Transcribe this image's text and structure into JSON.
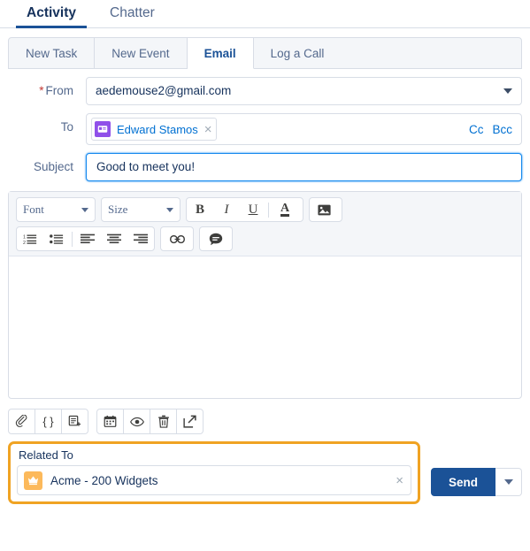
{
  "top_tabs": [
    {
      "label": "Activity",
      "active": true
    },
    {
      "label": "Chatter",
      "active": false
    }
  ],
  "sub_tabs": [
    {
      "label": "New Task",
      "active": false
    },
    {
      "label": "New Event",
      "active": false
    },
    {
      "label": "Email",
      "active": true
    },
    {
      "label": "Log a Call",
      "active": false
    }
  ],
  "form": {
    "from": {
      "label": "From",
      "required_marker": "*",
      "value": "aedemouse2@gmail.com"
    },
    "to": {
      "label": "To",
      "recipient": "Edward Stamos",
      "remove_icon": "×",
      "cc_label": "Cc",
      "bcc_label": "Bcc"
    },
    "subject": {
      "label": "Subject",
      "value": "Good to meet you!",
      "placeholder": "Subject"
    }
  },
  "editor": {
    "font_select": "Font",
    "size_select": "Size",
    "bold": "B",
    "italic": "I",
    "underline": "U",
    "text_color": "A",
    "image": "Ὓc",
    "body_value": ""
  },
  "action_icons": [
    {
      "name": "attach-file",
      "glyph": "📎"
    },
    {
      "name": "merge-fields",
      "glyph": "{ }"
    },
    {
      "name": "save-as-template",
      "glyph": "⎘"
    },
    {
      "name": "insert-availability",
      "glyph": "📅"
    },
    {
      "name": "preview",
      "glyph": "◉"
    },
    {
      "name": "discard-draft",
      "glyph": "🗑"
    },
    {
      "name": "pop-out",
      "glyph": "↗"
    }
  ],
  "related_to": {
    "label": "Related To",
    "value": "Acme - 200 Widgets",
    "clear_icon": "×"
  },
  "send": {
    "label": "Send"
  },
  "colors": {
    "brand_blue": "#1b5297",
    "link_blue": "#0070d2",
    "highlight_amber": "#f0a323",
    "opportunity_orange": "#fcb95b",
    "contact_purple": "#9050e9",
    "required_red": "#c23934"
  }
}
